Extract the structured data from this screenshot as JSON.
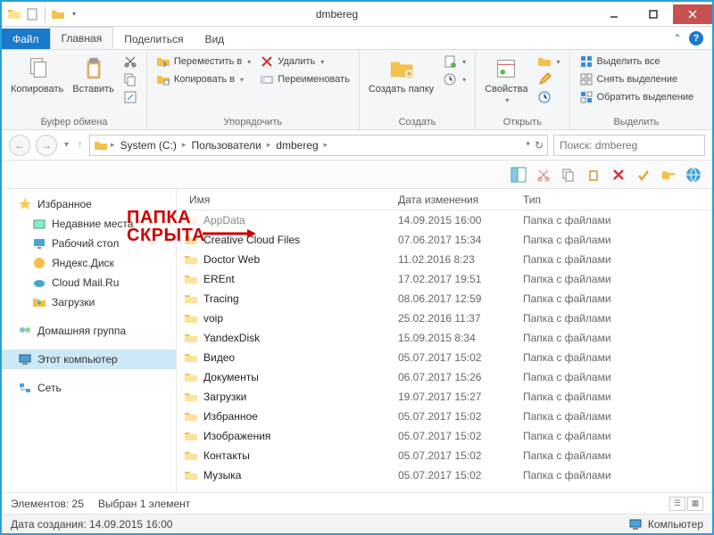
{
  "window": {
    "title": "dmbereg"
  },
  "tabs": {
    "file": "Файл",
    "home": "Главная",
    "share": "Поделиться",
    "view": "Вид"
  },
  "ribbon": {
    "clipboard": {
      "title": "Буфер обмена",
      "copy": "Копировать",
      "paste": "Вставить"
    },
    "organize": {
      "title": "Упорядочить",
      "move_to": "Переместить в",
      "copy_to": "Копировать в",
      "delete": "Удалить",
      "rename": "Переименовать"
    },
    "new": {
      "title": "Создать",
      "new_folder": "Создать папку"
    },
    "open": {
      "title": "Открыть",
      "properties": "Свойства"
    },
    "select": {
      "title": "Выделить",
      "select_all": "Выделить все",
      "select_none": "Снять выделение",
      "invert": "Обратить выделение"
    }
  },
  "breadcrumb": {
    "system": "System (C:)",
    "users": "Пользователи",
    "folder": "dmbereg"
  },
  "search": {
    "placeholder": "Поиск: dmbereg"
  },
  "nav": {
    "favorites": "Избранное",
    "recent": "Недавние места",
    "desktop": "Рабочий стол",
    "yandex_disk": "Яндекс.Диск",
    "cloud_mail": "Cloud Mail.Ru",
    "downloads": "Загрузки",
    "homegroup": "Домашняя группа",
    "this_pc": "Этот компьютер",
    "network": "Сеть"
  },
  "columns": {
    "name": "Имя",
    "date": "Дата изменения",
    "type": "Тип"
  },
  "type_folder": "Папка с файлами",
  "files": [
    {
      "name": "AppData",
      "date": "14.09.2015 16:00",
      "hidden": true
    },
    {
      "name": "Creative Cloud Files",
      "date": "07.06.2017 15:34"
    },
    {
      "name": "Doctor Web",
      "date": "11.02.2016 8:23"
    },
    {
      "name": "EREnt",
      "date": "17.02.2017 19:51"
    },
    {
      "name": "Tracing",
      "date": "08.06.2017 12:59"
    },
    {
      "name": "voip",
      "date": "25.02.2016 11:37"
    },
    {
      "name": "YandexDisk",
      "date": "15.09.2015 8:34"
    },
    {
      "name": "Видео",
      "date": "05.07.2017 15:02"
    },
    {
      "name": "Документы",
      "date": "06.07.2017 15:26"
    },
    {
      "name": "Загрузки",
      "date": "19.07.2017 15:27"
    },
    {
      "name": "Избранное",
      "date": "05.07.2017 15:02"
    },
    {
      "name": "Изображения",
      "date": "05.07.2017 15:02"
    },
    {
      "name": "Контакты",
      "date": "05.07.2017 15:02"
    },
    {
      "name": "Музыка",
      "date": "05.07.2017 15:02"
    }
  ],
  "status": {
    "elements": "Элементов: 25",
    "selected": "Выбран 1 элемент",
    "created": "Дата создания: 14.09.2015 16:00",
    "computer": "Компьютер"
  },
  "annotation": {
    "line1": "ПАПКА",
    "line2": "СКРЫТА"
  }
}
